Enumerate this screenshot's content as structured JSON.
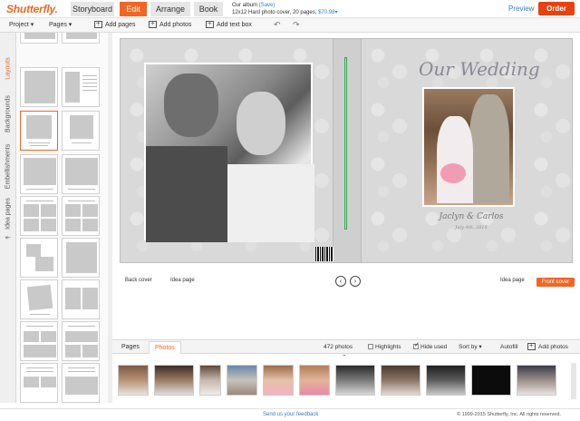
{
  "header": {
    "logo": "Shutterfly.",
    "tabs": [
      {
        "label": "Storyboard",
        "active": false
      },
      {
        "label": "Edit",
        "active": true
      },
      {
        "label": "Arrange",
        "active": false
      },
      {
        "label": "Book",
        "active": false
      }
    ],
    "album": {
      "name": "Our album",
      "save_link": "(Save)",
      "details": "12x12 Hard photo cover, 20 pages,",
      "price": "$70.98",
      "price_caret": "▾"
    },
    "preview": "Preview",
    "order": "Order"
  },
  "toolbar": {
    "project": "Project ▾",
    "pages": "Pages ▾",
    "add_pages": "Add pages",
    "add_photos": "Add photos",
    "add_text_box": "Add text box",
    "undo_icon": "undo-icon",
    "redo_icon": "redo-icon"
  },
  "side_tabs": [
    {
      "label": "Layouts",
      "active": true
    },
    {
      "label": "Backgrounds",
      "active": false
    },
    {
      "label": "Embellishments",
      "active": false
    },
    {
      "label": "Idea pages",
      "active": false
    }
  ],
  "collapse_arrow": "⇤",
  "book": {
    "cover_title": "Our Wedding",
    "names": "Jaclyn & Carlos",
    "date": "July 4th, 2015",
    "barcode_text": "|||||||||"
  },
  "page_labels": {
    "back_cover": "Back cover",
    "idea_page_left": "Idea page",
    "idea_page_right": "Idea page",
    "front_cover": "Front cover",
    "prev": "‹",
    "next": "›"
  },
  "photo_tray": {
    "tabs": [
      {
        "label": "Pages",
        "active": false
      },
      {
        "label": "Photos",
        "active": true
      }
    ],
    "count": "472 photos",
    "highlights": "Highlights",
    "hide_used": "Hide used",
    "sort_by": "Sort by ▾",
    "autofill": "Autofill",
    "add_photos": "Add photos",
    "collapse": "⌃"
  },
  "footer": {
    "feedback": "Send us your feedback",
    "copyright": "© 1999-2015 Shutterfly, Inc. All rights reserved."
  },
  "colors": {
    "brand": "#f26522",
    "order": "#e8420f",
    "link": "#3b7dc4",
    "spine_line": "#3ca55c"
  }
}
